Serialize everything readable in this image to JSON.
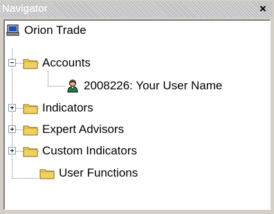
{
  "window": {
    "title": "Navigator",
    "close_glyph": "×"
  },
  "tree": {
    "root": {
      "label": "Orion Trade",
      "icon": "computer-icon"
    },
    "items": [
      {
        "label": "Accounts",
        "icon": "folder-icon",
        "expanded": true,
        "children": [
          {
            "label": "2008226: Your User Name",
            "icon": "user-account-icon"
          }
        ]
      },
      {
        "label": "Indicators",
        "icon": "folder-icon",
        "expanded": false
      },
      {
        "label": "Expert Advisors",
        "icon": "folder-icon",
        "expanded": false
      },
      {
        "label": "Custom Indicators",
        "icon": "folder-icon",
        "expanded": false
      },
      {
        "label": "User Functions",
        "icon": "folder-icon",
        "expanded": null
      }
    ]
  },
  "colors": {
    "folder": "#f0d060",
    "folder_dark": "#c8a020",
    "panel_bg": "#d4d0c8"
  }
}
